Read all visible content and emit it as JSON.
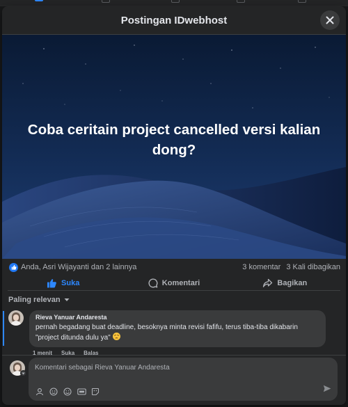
{
  "window": {
    "title": "Postingan IDwebhost"
  },
  "post": {
    "text": "Coba ceritain project cancelled versi kalian dong?"
  },
  "stats": {
    "reactions": "Anda, Asri Wijayanti dan 2 lainnya",
    "comments": "3 komentar",
    "shares": "3 Kali dibagikan"
  },
  "actions": {
    "like": "Suka",
    "comment": "Komentari",
    "share": "Bagikan"
  },
  "sort": {
    "label": "Paling relevan"
  },
  "comments": [
    {
      "author": "Rieva Yanuar Andaresta",
      "text": "pernah begadang buat deadline, besoknya minta revisi fafifu, terus tiba-tiba dikabarin \"project ditunda dulu ya\"",
      "time": "1 menit",
      "like": "Suka",
      "reply": "Balas"
    }
  ],
  "composer": {
    "placeholder": "Komentari sebagai Rieva Yanuar Andaresta"
  },
  "icons": {
    "close": "close-icon",
    "like": "thumbs-up-icon",
    "comment": "comment-bubble-icon",
    "share": "share-arrow-icon",
    "sort": "chevron-down-icon",
    "send": "send-icon"
  },
  "colors": {
    "accent": "#2d88ff",
    "surface": "#242526",
    "bubble": "#3a3b3c"
  }
}
